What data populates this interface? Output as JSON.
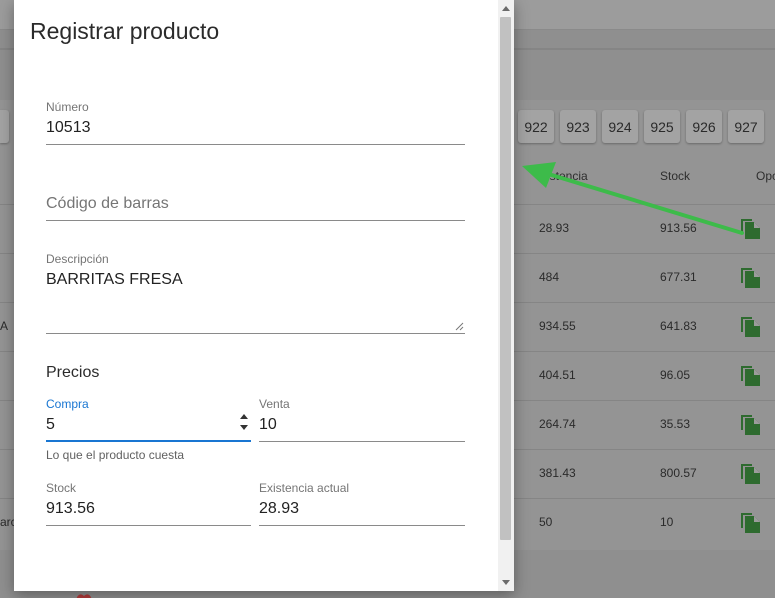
{
  "background": {
    "pages": [
      "922",
      "923",
      "924",
      "925",
      "926",
      "927"
    ],
    "columns": {
      "existencia": "istencia",
      "stock": "Stock",
      "opciones": "Opc"
    },
    "rows": [
      {
        "prefix": "",
        "existencia": "28.93",
        "stock": "913.56"
      },
      {
        "prefix": "",
        "existencia": "484",
        "stock": "677.31"
      },
      {
        "prefix": "A",
        "existencia": "934.55",
        "stock": "641.83"
      },
      {
        "prefix": "",
        "existencia": "404.51",
        "stock": "96.05"
      },
      {
        "prefix": "",
        "existencia": "264.74",
        "stock": "35.53"
      },
      {
        "prefix": "",
        "existencia": "381.43",
        "stock": "800.57"
      },
      {
        "prefix": "arc",
        "existencia": "50",
        "stock": "10"
      }
    ],
    "icon_color": "#2e6b2f",
    "arrow_color": "#3dbb4a"
  },
  "modal": {
    "title": "Registrar producto",
    "numero": {
      "label": "Número",
      "value": "10513"
    },
    "codigo": {
      "placeholder": "Código de barras"
    },
    "descripcion": {
      "label": "Descripción",
      "value": "BARRITAS FRESA"
    },
    "precios_title": "Precios",
    "compra": {
      "label": "Compra",
      "value": "5",
      "helper": "Lo que el producto cuesta"
    },
    "venta": {
      "label": "Venta",
      "value": "10"
    },
    "stock": {
      "label": "Stock",
      "value": "913.56"
    },
    "existencia": {
      "label": "Existencia actual",
      "value": "28.93"
    },
    "accent_color": "#1976d2"
  }
}
